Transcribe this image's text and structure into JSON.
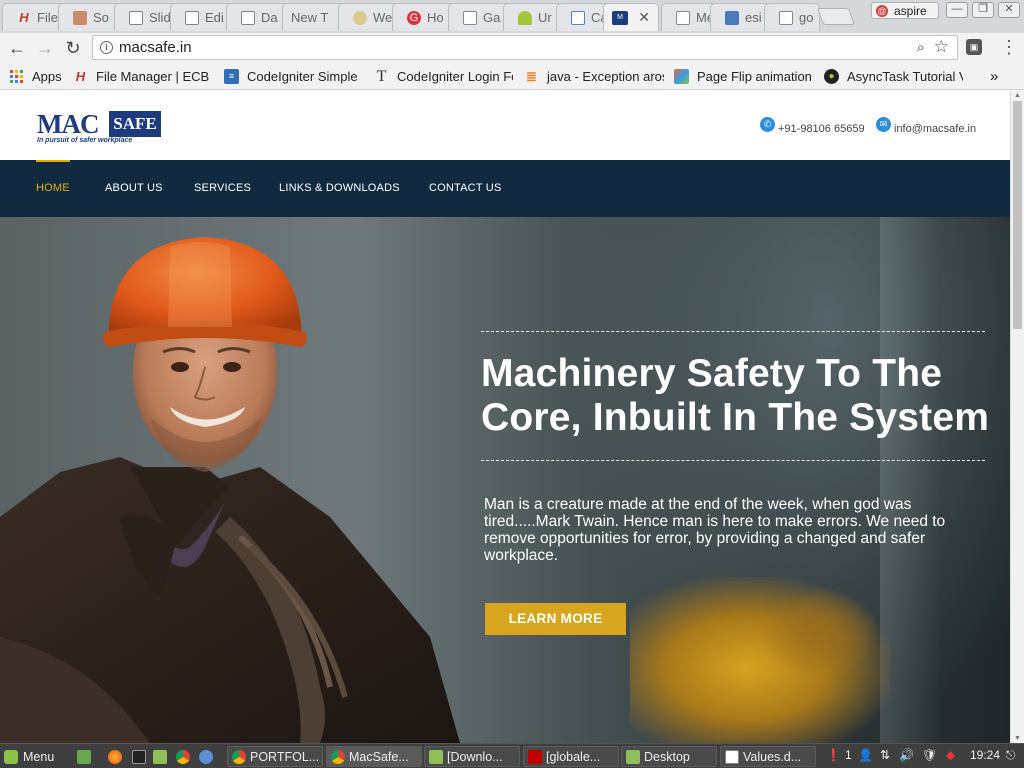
{
  "browser": {
    "tabs": [
      {
        "label": "File",
        "icon": "h-logo-icon"
      },
      {
        "label": "So",
        "icon": "stamp-icon"
      },
      {
        "label": "Slid",
        "icon": "page-icon"
      },
      {
        "label": "Edi",
        "icon": "page-icon"
      },
      {
        "label": "Da",
        "icon": "page-icon"
      },
      {
        "label": "New T",
        "icon": ""
      },
      {
        "label": "We",
        "icon": "circle-logo-icon"
      },
      {
        "label": "Ho",
        "icon": "red-badge-icon"
      },
      {
        "label": "Ga",
        "icon": "page-icon"
      },
      {
        "label": "Ur",
        "icon": "android-icon"
      },
      {
        "label": "Ca",
        "icon": "calendar-icon"
      },
      {
        "label": "",
        "icon": "macsafe-favicon",
        "active": true
      },
      {
        "label": "Me",
        "icon": "page-icon"
      },
      {
        "label": "esi",
        "icon": "blue-square-icon"
      },
      {
        "label": "go",
        "icon": "page-icon"
      }
    ],
    "profile_name": "aspire",
    "url": "macsafe.in",
    "bookmarks": [
      {
        "label": "Apps",
        "icon": "apps-grid-icon"
      },
      {
        "label": "File Manager | ECB",
        "icon": "h-logo-icon"
      },
      {
        "label": "CodeIgniter Simple",
        "icon": "doc-blue-icon"
      },
      {
        "label": "CodeIgniter Login Fo",
        "icon": "t-serif-icon"
      },
      {
        "label": "java - Exception aros",
        "icon": "stack-icon"
      },
      {
        "label": "Page Flip animation",
        "icon": "mosaic-icon"
      },
      {
        "label": "AsyncTask Tutorial V",
        "icon": "android-icon"
      }
    ],
    "bookmarks_overflow": "»"
  },
  "site": {
    "logo": {
      "mac": "MAC",
      "safe": "SAFE",
      "tagline": "In pursuit of safer workplace"
    },
    "phone": "+91-98106 65659",
    "email": "info@macsafe.in",
    "nav": [
      "HOME",
      "ABOUT US",
      "SERVICES",
      "LINKS & DOWNLOADS",
      "CONTACT US"
    ],
    "hero": {
      "title_line1": "Machinery Safety To The",
      "title_line2": "Core, Inbuilt In The System",
      "text": "Man is a creature made at the end of the week, when god was tired.....Mark Twain. Hence man is here to make errors. We need to remove opportunities for error, by providing a changed and safer workplace.",
      "button": "LEARN MORE"
    }
  },
  "taskbar": {
    "menu_label": "Menu",
    "windows": [
      {
        "label": "PORTFOL...",
        "icon": "chrome-icon"
      },
      {
        "label": "MacSafe...",
        "icon": "chrome-icon",
        "active": true
      },
      {
        "label": "[Downlo...",
        "icon": "folder-icon"
      },
      {
        "label": "[globale...",
        "icon": "filezilla-icon"
      },
      {
        "label": "Desktop",
        "icon": "folder-icon"
      },
      {
        "label": "Values.d...",
        "icon": "doc-icon"
      }
    ],
    "tray_count": "1",
    "clock": "19:24"
  },
  "colors": {
    "nav_bg": "#122a3f",
    "accent": "#e0ad0c",
    "logo_blue": "#1d3b7e",
    "button": "#d8a61e"
  }
}
